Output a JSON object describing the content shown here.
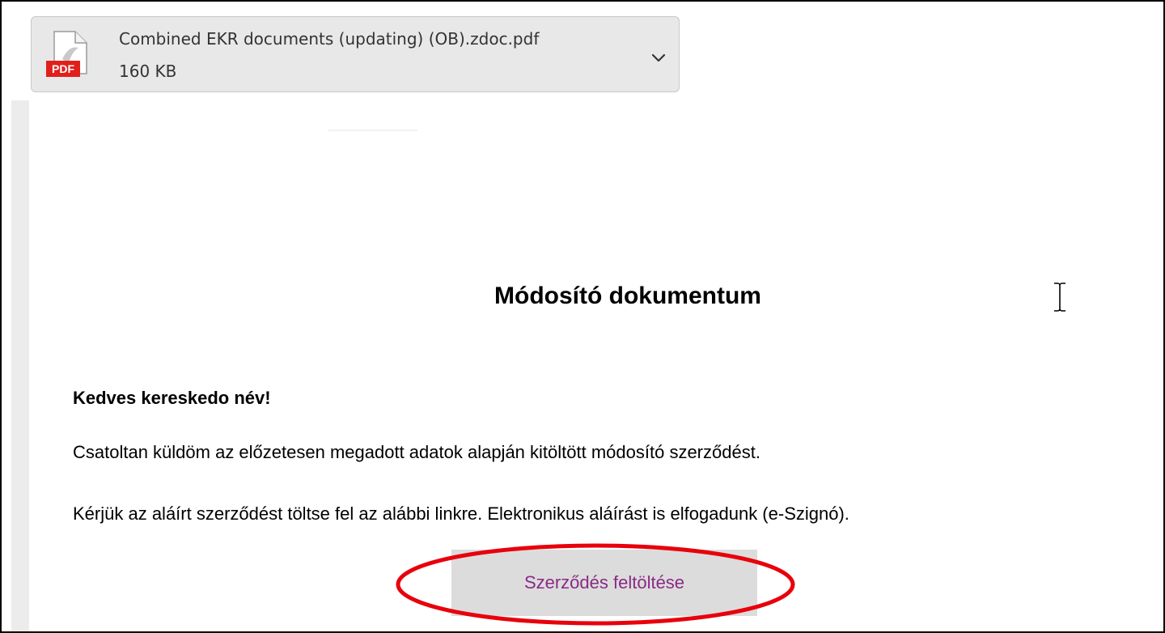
{
  "attachment": {
    "file_name": "Combined EKR documents (updating) (OB).zdoc.pdf",
    "file_size": "160 KB",
    "icon": "pdf-file-icon",
    "icon_badge": "PDF",
    "badge_color": "#e0201a",
    "menu_icon": "chevron-down-icon"
  },
  "email": {
    "title": "Módosító dokumentum",
    "greeting": "Kedves kereskedo név!",
    "paragraphs": [
      "Csatoltan küldöm az előzetesen megadott adatok alapján kitöltött módosító szerződést.",
      "Kérjük az aláírt szerződést töltse fel az alábbi linkre. Elektronikus aláírást is elfogadunk (e-Szignó)."
    ],
    "button_label": "Szerződés feltöltése",
    "button_text_color": "#8a2a86",
    "highlight_color": "#e8000b"
  },
  "pointer": {
    "icon": "text-cursor-icon"
  }
}
